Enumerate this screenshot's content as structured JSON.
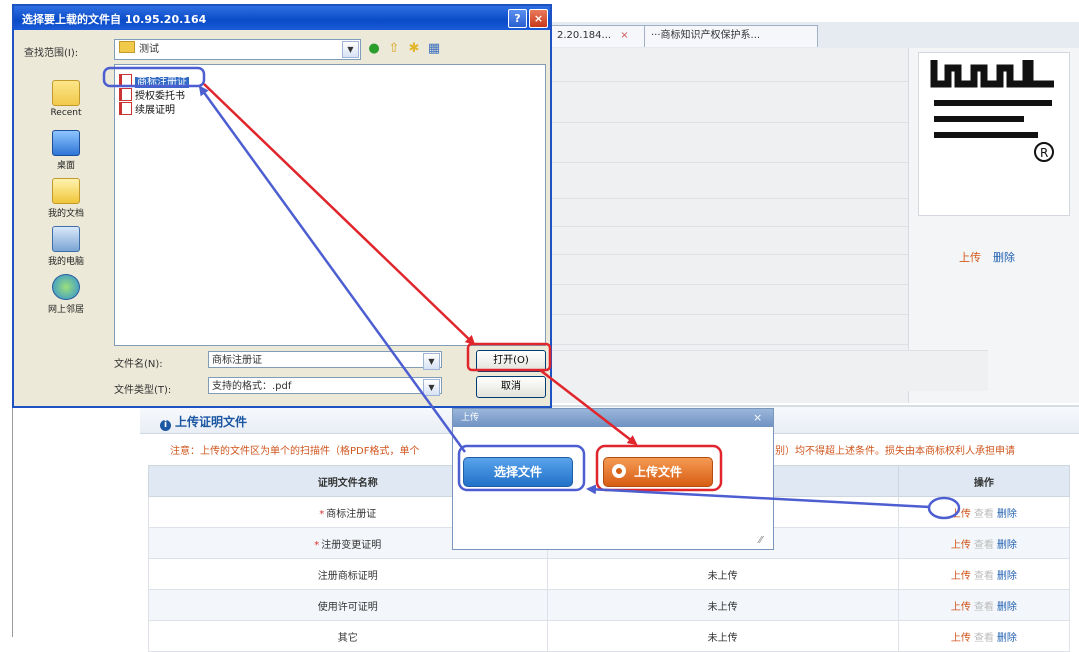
{
  "browser_tabs": [
    {
      "label": "2.20.184... ",
      "close": "×"
    },
    {
      "label": "···商标知识产权保护系..."
    }
  ],
  "trademark": {
    "upload_link": "上传",
    "delete_link": "删除"
  },
  "dialog": {
    "title": "选择要上载的文件自 10.95.20.164",
    "help": "?",
    "close": "×",
    "look_in_label": "查找范围(I):",
    "look_in_value": "测试",
    "places": [
      {
        "label": "Recent"
      },
      {
        "label": "桌面"
      },
      {
        "label": "我的文档"
      },
      {
        "label": "我的电脑"
      },
      {
        "label": "网上邻居"
      }
    ],
    "files": [
      {
        "name": "商标注册证",
        "selected": true
      },
      {
        "name": "授权委托书",
        "selected": false
      },
      {
        "name": "续展证明",
        "selected": false
      }
    ],
    "filename_label": "文件名(N):",
    "filename_value": "商标注册证",
    "filetype_label": "文件类型(T):",
    "filetype_value": "支持的格式：.pdf",
    "open_button": "打开(O)",
    "cancel_button": "取消"
  },
  "upload_section": {
    "title": "上传证明文件",
    "icon_glyph": "i",
    "notice_left": "注意：上传的文件区为单个的扫描件（格PDF格式，单个",
    "notice_right": "别）均不得超上述条件。损失由本商标权利人承担申请",
    "columns": [
      "证明文件名称",
      "",
      "操作"
    ],
    "rows": [
      {
        "required": true,
        "name": "商标注册证",
        "status": "",
        "ops": [
          "上传",
          "查看",
          "删除"
        ]
      },
      {
        "required": true,
        "name": "注册变更证明",
        "status": "",
        "ops": [
          "上传",
          "查看",
          "删除"
        ]
      },
      {
        "required": false,
        "name": "注册商标证明",
        "status": "未上传",
        "ops": [
          "上传",
          "查看",
          "删除"
        ]
      },
      {
        "required": false,
        "name": "使用许可证明",
        "status": "未上传",
        "ops": [
          "上传",
          "查看",
          "删除"
        ]
      },
      {
        "required": false,
        "name": "其它",
        "status": "未上传",
        "ops": [
          "上传",
          "查看",
          "删除"
        ]
      }
    ]
  },
  "upload_popup": {
    "title": "上传",
    "close": "×",
    "choose_button": "选择文件",
    "upload_button": "上传文件",
    "resize_grip": "⁄⁄"
  },
  "colors": {
    "annotation_red": "#e0262c",
    "annotation_blue": "#4d5ed1",
    "xp_title_blue": "#0a4bc8",
    "accent_orange": "#d75d13"
  }
}
